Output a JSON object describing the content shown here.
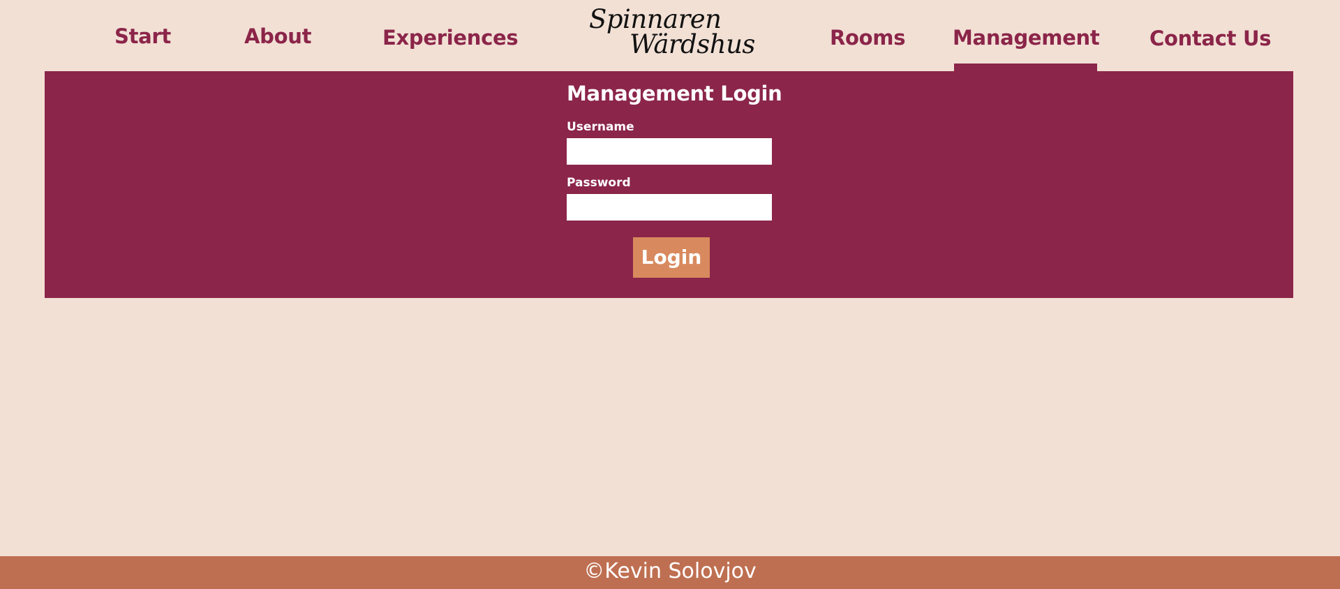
{
  "nav": {
    "start": "Start",
    "about": "About",
    "experiences": "Experiences",
    "rooms": "Rooms",
    "management": "Management",
    "contact": "Contact Us",
    "active": "Management"
  },
  "logo": {
    "line1": "Spinnaren",
    "line2": "Wärdshus"
  },
  "login": {
    "title": "Management Login",
    "username_label": "Username",
    "username_value": "",
    "password_label": "Password",
    "password_value": "",
    "button_label": "Login"
  },
  "footer": {
    "text": "©Kevin Solovjov"
  },
  "colors": {
    "background": "#f2e0d5",
    "brand": "#8b2549",
    "button": "#d88a5e",
    "footer": "#bf6f51"
  }
}
